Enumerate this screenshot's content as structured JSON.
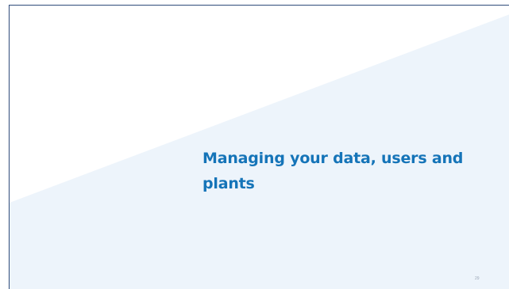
{
  "slide": {
    "title": "Managing your data, users and plants",
    "page_number": "29"
  },
  "colors": {
    "background": "#ffffff",
    "panel": "#edf4fb",
    "title": "#1574b8",
    "border": "#2f4b7a"
  }
}
